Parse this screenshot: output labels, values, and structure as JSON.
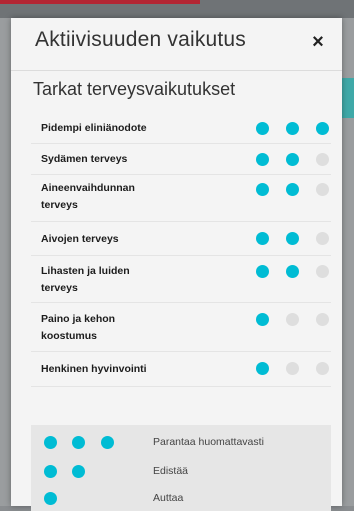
{
  "modal": {
    "title": "Aktiivisuuden vaikutus",
    "close_icon": "×",
    "section_title": "Tarkat terveysvaikutukset"
  },
  "effects": [
    {
      "label": "Pidempi eliniänodote",
      "level": 3
    },
    {
      "label": "Sydämen terveys",
      "level": 2
    },
    {
      "label": "Aineenvaihdunnan terveys",
      "level": 2
    },
    {
      "label": "Aivojen terveys",
      "level": 2
    },
    {
      "label": "Lihasten ja luiden terveys",
      "level": 2
    },
    {
      "label": "Paino ja kehon koostumus",
      "level": 1
    },
    {
      "label": "Henkinen hyvinvointi",
      "level": 1
    }
  ],
  "legend": [
    {
      "dots": 3,
      "label": "Parantaa huomattavasti"
    },
    {
      "dots": 2,
      "label": "Edistää"
    },
    {
      "dots": 1,
      "label": "Auttaa"
    }
  ],
  "colors": {
    "dot_on": "#00bcd4",
    "dot_off": "#dedede"
  }
}
